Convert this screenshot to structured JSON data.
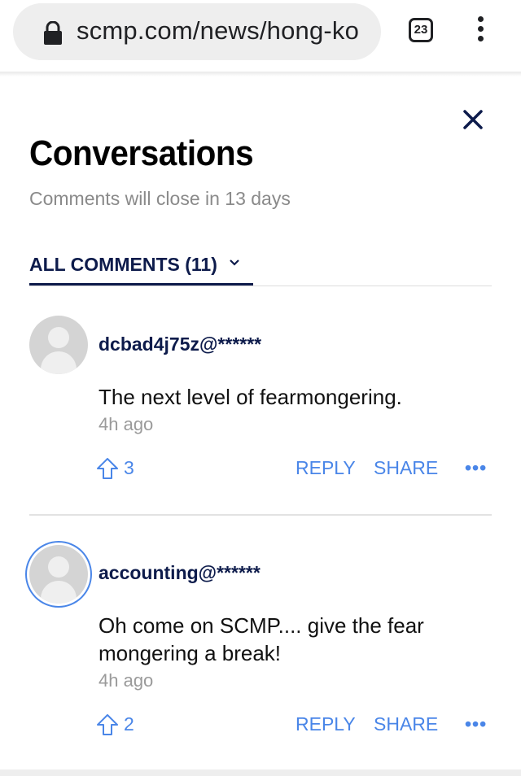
{
  "browser": {
    "url": "scmp.com/news/hong-ko",
    "tab_count": "23",
    "icons": [
      "lock-icon",
      "tabs-icon",
      "more-vert-icon"
    ]
  },
  "panel": {
    "title": "Conversations",
    "subtitle": "Comments will close in 13 days",
    "tab_label": "ALL COMMENTS (11)"
  },
  "comments": [
    {
      "user": "dcbad4j75z@******",
      "text": "The next level of fearmongering.",
      "time": "4h ago",
      "votes": "3",
      "reply": "REPLY",
      "share": "SHARE",
      "more": "•••"
    },
    {
      "user": "accounting@******",
      "text": "Oh come on SCMP.... give the fear mongering a break!",
      "time": "4h ago",
      "votes": "2",
      "reply": "REPLY",
      "share": "SHARE",
      "more": "•••"
    }
  ],
  "colors": {
    "accent_blue": "#4a86e8",
    "navy": "#0d1b4b"
  }
}
